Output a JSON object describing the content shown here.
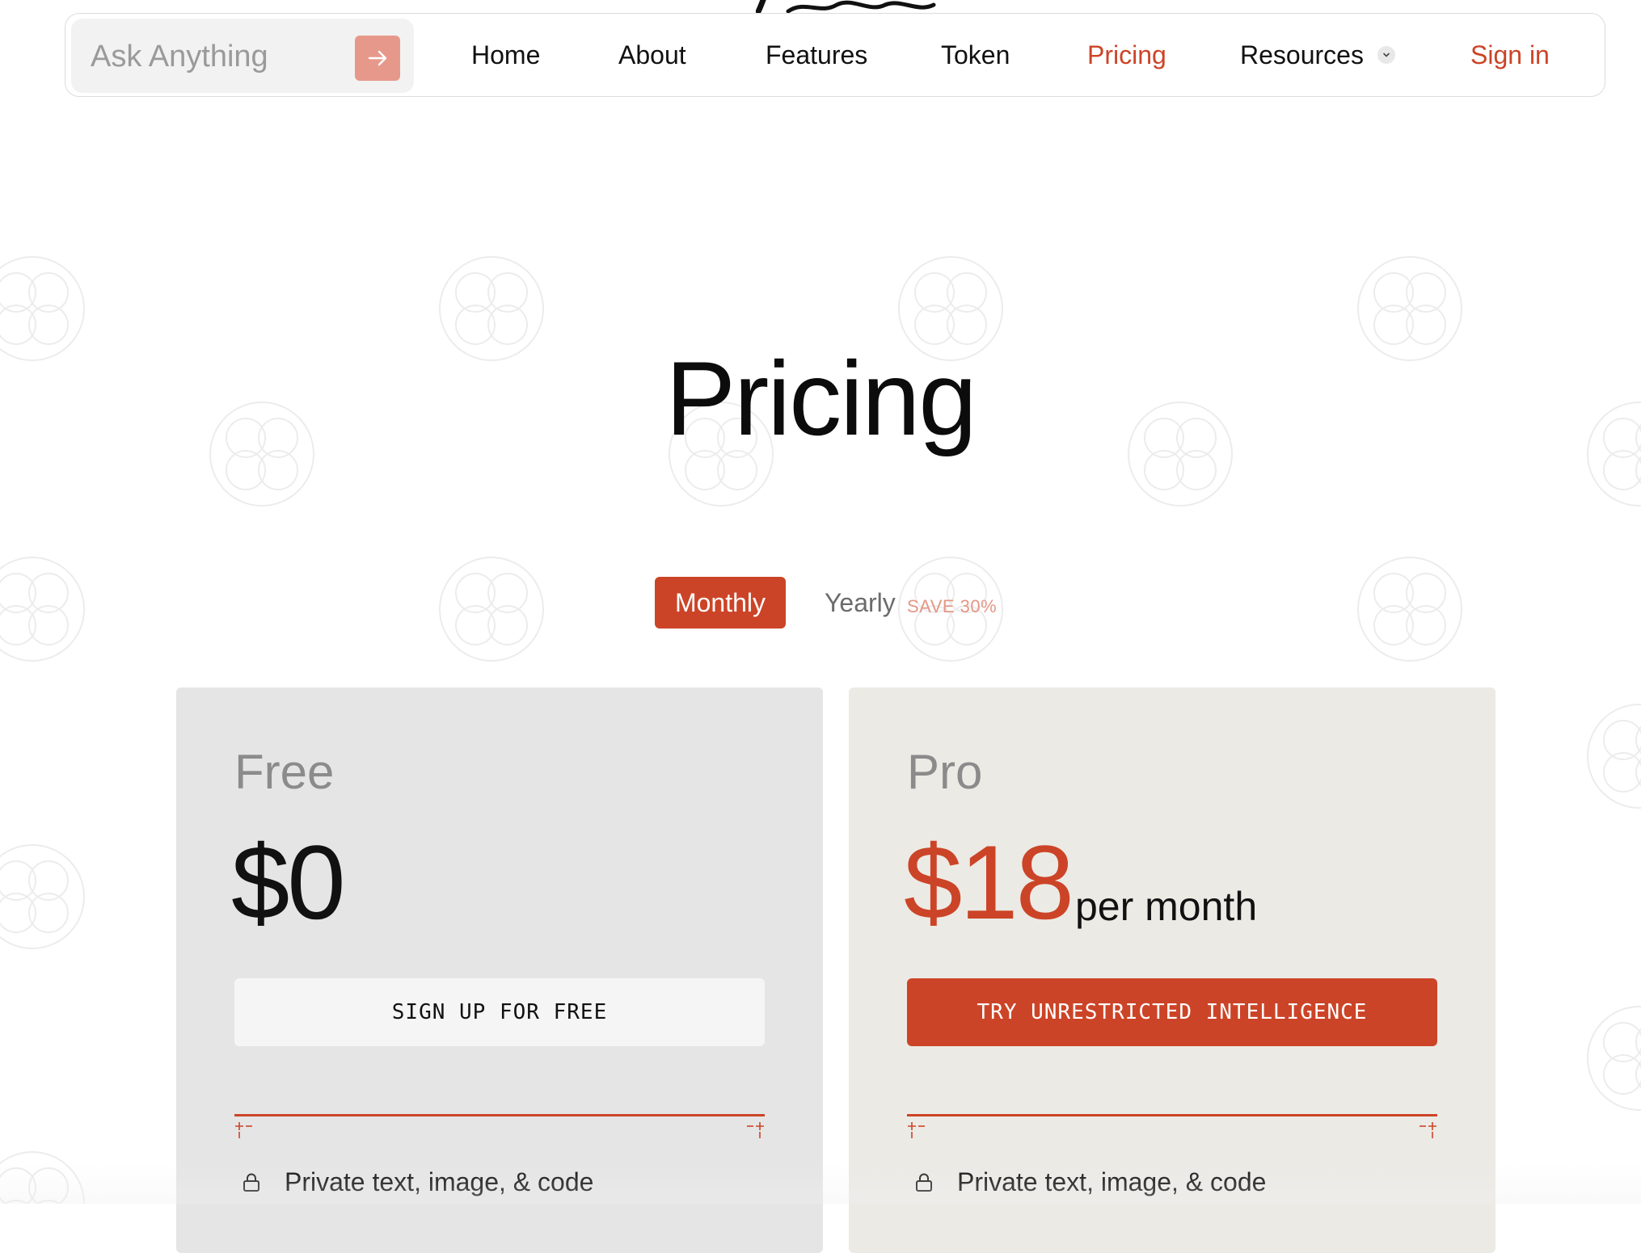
{
  "search": {
    "placeholder": "Ask Anything",
    "submit_icon": "arrow-right-icon"
  },
  "nav": {
    "items": [
      {
        "label": "Home"
      },
      {
        "label": "About"
      },
      {
        "label": "Features"
      },
      {
        "label": "Token"
      },
      {
        "label": "Pricing",
        "active": true
      },
      {
        "label": "Resources",
        "has_dropdown": true
      }
    ],
    "sign_in": "Sign in"
  },
  "page": {
    "title": "Pricing"
  },
  "billing_toggle": {
    "monthly": "Monthly",
    "yearly": "Yearly",
    "save_badge": "SAVE 30%",
    "selected": "Monthly"
  },
  "plans": [
    {
      "name": "Free",
      "price": "$0",
      "suffix": "",
      "cta": "SIGN UP FOR FREE",
      "features": [
        {
          "icon": "lock-icon",
          "label": "Private text, image, & code"
        }
      ]
    },
    {
      "name": "Pro",
      "price": "$18",
      "suffix": "per month",
      "cta": "TRY UNRESTRICTED INTELLIGENCE",
      "features": [
        {
          "icon": "lock-icon",
          "label": "Private text, image, & code"
        }
      ]
    }
  ],
  "colors": {
    "accent": "#cc4427",
    "accent_soft": "#e6998a",
    "free_card_bg": "#e5e5e5",
    "pro_card_bg": "#eceae5"
  }
}
